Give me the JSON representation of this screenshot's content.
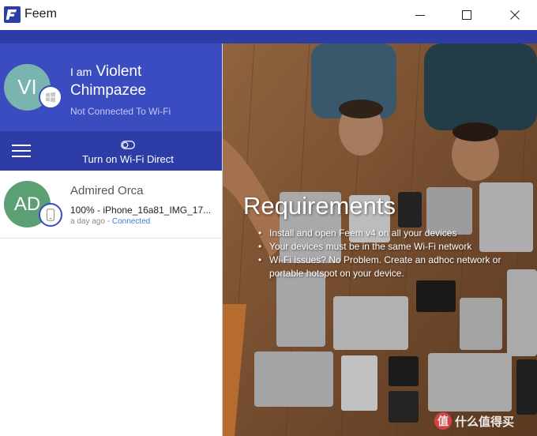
{
  "window": {
    "title": "Feem",
    "minimize_icon": "minimize-icon",
    "maximize_icon": "maximize-icon",
    "close_icon": "close-icon"
  },
  "theme": {
    "primary": "#3a4cc0",
    "primary_dark": "#2d3ca6",
    "profile_avatar": "#7ab4b0",
    "device_avatar": "#5b9f74",
    "connected_link": "#3a7fd4"
  },
  "profile": {
    "initials": "VI",
    "name_prefix": "I am",
    "name": "Violent Chimpazee",
    "status": "Not Connected To Wi-Fi",
    "platform_icon": "windows-icon"
  },
  "toolbar": {
    "menu_icon": "hamburger-menu-icon",
    "wifi_direct_icon": "toggle-icon",
    "wifi_direct_label": "Turn on Wi-Fi Direct"
  },
  "devices": [
    {
      "initials": "AD",
      "name": "Admired Orca",
      "transfer": "100% - iPhone_16a81_IMG_17...",
      "time": "a day ago",
      "separator": "-",
      "status": "Connected",
      "platform_icon": "phone-icon"
    }
  ],
  "requirements": {
    "title": "Requirements",
    "items": [
      "Install and open Feem v4 on all your devices",
      "Your devices must be in the same Wi-Fi network",
      "Wi-Fi issues? No Problem. Create an adhoc network or portable hotspot on your device."
    ]
  },
  "watermark": {
    "badge": "值",
    "text": "什么值得买"
  }
}
